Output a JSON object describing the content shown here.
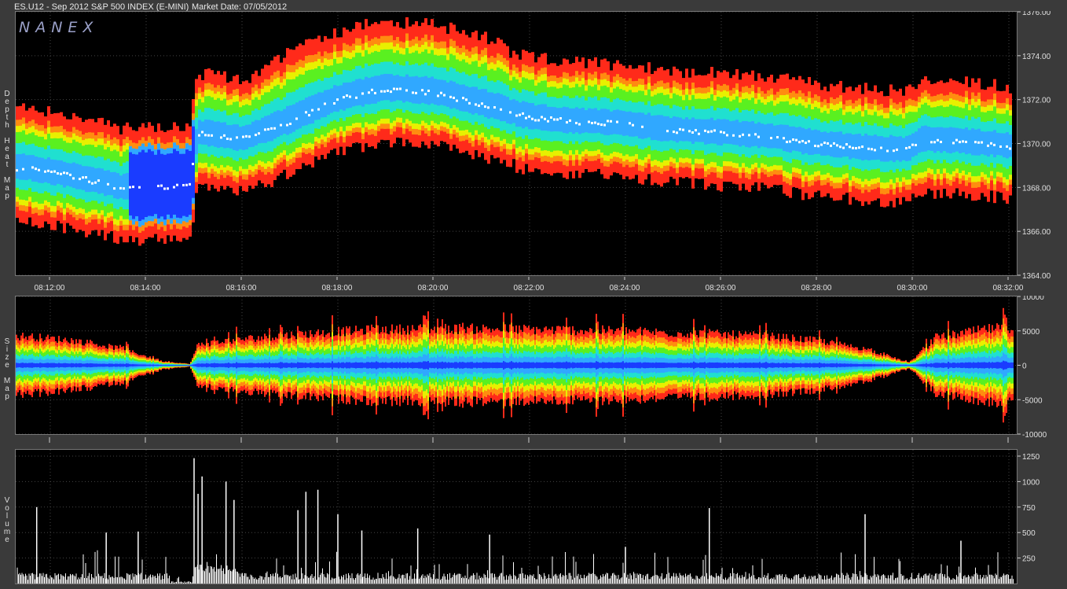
{
  "header": {
    "symbol_title": "ES.U12 - Sep 2012 S&P 500 INDEX (E-MINI)",
    "market_date": "Market Date: 07/05/2012"
  },
  "logo": "NANEX",
  "panel_labels": {
    "depth": "Depth Heat Map",
    "size": "Size Map",
    "volume": "Volume"
  },
  "colors": {
    "red": "#ff2a1a",
    "orange": "#ff8c10",
    "yellow": "#e8f000",
    "green": "#5af020",
    "cyan": "#20e0d0",
    "lightblue": "#30a8ff",
    "blue": "#1a3cff",
    "white": "#ffffff"
  },
  "chart_data": [
    {
      "type": "heatmap",
      "name": "depth",
      "x_ticks": [
        "08:12:00",
        "08:14:00",
        "08:16:00",
        "08:18:00",
        "08:20:00",
        "08:22:00",
        "08:24:00",
        "08:26:00",
        "08:28:00",
        "08:30:00",
        "08:32:00"
      ],
      "y_ticks": [
        "1376.00",
        "1374.00",
        "1372.00",
        "1370.00",
        "1368.00",
        "1366.00",
        "1364.00"
      ],
      "ylim": [
        1364,
        1376
      ],
      "xlim_minutes": [
        8.11,
        8.54
      ],
      "mid_price": [
        {
          "t": "08:11:30",
          "p": 1368.9
        },
        {
          "t": "08:12:30",
          "p": 1368.5
        },
        {
          "t": "08:13:30",
          "p": 1368.0
        },
        {
          "t": "08:14:55",
          "p": 1368.1
        },
        {
          "t": "08:15:05",
          "p": 1370.5
        },
        {
          "t": "08:16:00",
          "p": 1370.2
        },
        {
          "t": "08:17:00",
          "p": 1371.0
        },
        {
          "t": "08:18:00",
          "p": 1372.0
        },
        {
          "t": "08:19:00",
          "p": 1372.5
        },
        {
          "t": "08:20:00",
          "p": 1372.3
        },
        {
          "t": "08:21:00",
          "p": 1371.8
        },
        {
          "t": "08:22:00",
          "p": 1371.2
        },
        {
          "t": "08:23:00",
          "p": 1371.0
        },
        {
          "t": "08:24:00",
          "p": 1370.9
        },
        {
          "t": "08:25:00",
          "p": 1370.6
        },
        {
          "t": "08:26:00",
          "p": 1370.5
        },
        {
          "t": "08:27:00",
          "p": 1370.3
        },
        {
          "t": "08:28:00",
          "p": 1370.0
        },
        {
          "t": "08:29:00",
          "p": 1369.8
        },
        {
          "t": "08:29:55",
          "p": 1369.7
        },
        {
          "t": "08:30:10",
          "p": 1370.2
        },
        {
          "t": "08:31:00",
          "p": 1370.1
        },
        {
          "t": "08:32:00",
          "p": 1369.9
        },
        {
          "t": "08:32:30",
          "p": 1369.6
        }
      ]
    },
    {
      "type": "area",
      "name": "size",
      "y_ticks": [
        "10000",
        "5000",
        "0",
        "-5000",
        "-10000"
      ],
      "ylim": [
        -10000,
        10000
      ],
      "envelope": [
        {
          "t": "08:11:30",
          "v": 4200
        },
        {
          "t": "08:12:30",
          "v": 3600
        },
        {
          "t": "08:13:30",
          "v": 2400
        },
        {
          "t": "08:14:20",
          "v": 600
        },
        {
          "t": "08:14:55",
          "v": 200
        },
        {
          "t": "08:15:05",
          "v": 3000
        },
        {
          "t": "08:16:00",
          "v": 3800
        },
        {
          "t": "08:17:00",
          "v": 4400
        },
        {
          "t": "08:18:00",
          "v": 4900
        },
        {
          "t": "08:19:00",
          "v": 5200
        },
        {
          "t": "08:20:00",
          "v": 5300
        },
        {
          "t": "08:21:00",
          "v": 5300
        },
        {
          "t": "08:22:00",
          "v": 5200
        },
        {
          "t": "08:23:00",
          "v": 5100
        },
        {
          "t": "08:24:00",
          "v": 5000
        },
        {
          "t": "08:25:00",
          "v": 4700
        },
        {
          "t": "08:26:00",
          "v": 4500
        },
        {
          "t": "08:27:00",
          "v": 4200
        },
        {
          "t": "08:28:00",
          "v": 3600
        },
        {
          "t": "08:29:00",
          "v": 2400
        },
        {
          "t": "08:29:55",
          "v": 400
        },
        {
          "t": "08:30:30",
          "v": 4000
        },
        {
          "t": "08:31:30",
          "v": 5200
        },
        {
          "t": "08:32:30",
          "v": 5800
        }
      ]
    },
    {
      "type": "bar",
      "name": "volume",
      "y_ticks": [
        "1250",
        "1000",
        "750",
        "500",
        "250"
      ],
      "ylim": [
        0,
        1250
      ],
      "spikes": [
        {
          "t": "08:11:43",
          "v": 750
        },
        {
          "t": "08:13:10",
          "v": 500
        },
        {
          "t": "08:13:50",
          "v": 510
        },
        {
          "t": "08:15:00",
          "v": 1230
        },
        {
          "t": "08:15:05",
          "v": 880
        },
        {
          "t": "08:15:10",
          "v": 1050
        },
        {
          "t": "08:15:40",
          "v": 1000
        },
        {
          "t": "08:15:50",
          "v": 820
        },
        {
          "t": "08:17:10",
          "v": 720
        },
        {
          "t": "08:17:20",
          "v": 900
        },
        {
          "t": "08:17:35",
          "v": 920
        },
        {
          "t": "08:18:00",
          "v": 680
        },
        {
          "t": "08:18:30",
          "v": 520
        },
        {
          "t": "08:19:40",
          "v": 540
        },
        {
          "t": "08:21:10",
          "v": 480
        },
        {
          "t": "08:24:00",
          "v": 360
        },
        {
          "t": "08:25:45",
          "v": 740
        },
        {
          "t": "08:29:00",
          "v": 680
        },
        {
          "t": "08:31:00",
          "v": 420
        },
        {
          "t": "08:32:20",
          "v": 540
        }
      ]
    }
  ]
}
